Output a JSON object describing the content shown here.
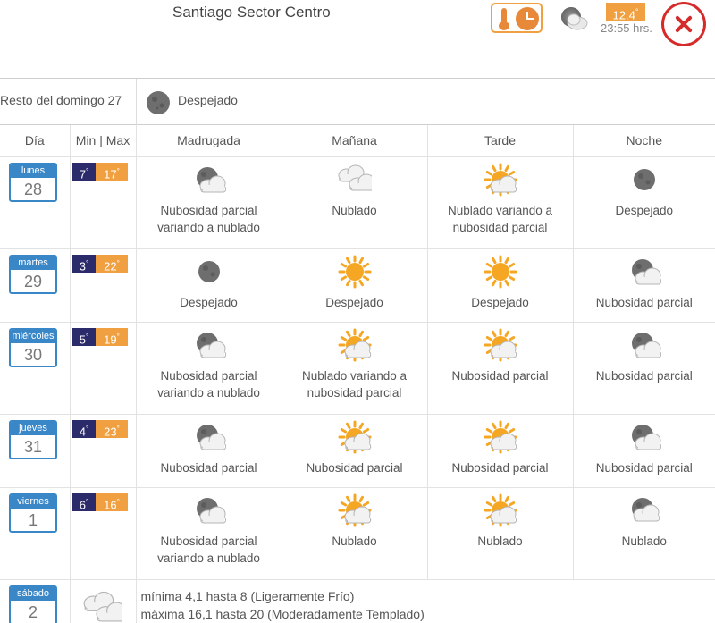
{
  "header": {
    "location": "Santiago Sector Centro",
    "current_temp": "12.4",
    "current_time": "23:55 hrs.",
    "current_icon": "partly-cloudy-night-icon"
  },
  "rest": {
    "label": "Resto del domingo 27",
    "desc": "Despejado",
    "icon": "clear-night-icon"
  },
  "table": {
    "headers": [
      "Día",
      "Min | Max",
      "Madrugada",
      "Mañana",
      "Tarde",
      "Noche"
    ],
    "days": [
      {
        "name": "lunes",
        "num": "28",
        "min": "7",
        "max": "17",
        "periods": [
          {
            "icon": "partly-cloudy-night",
            "desc": "Nubosidad parcial variando a nublado"
          },
          {
            "icon": "cloudy",
            "desc": "Nublado"
          },
          {
            "icon": "partly-cloudy-day",
            "desc": "Nublado variando a nubosidad parcial"
          },
          {
            "icon": "clear-night",
            "desc": "Despejado"
          }
        ]
      },
      {
        "name": "martes",
        "num": "29",
        "min": "3",
        "max": "22",
        "periods": [
          {
            "icon": "clear-night",
            "desc": "Despejado"
          },
          {
            "icon": "sunny",
            "desc": "Despejado"
          },
          {
            "icon": "sunny",
            "desc": "Despejado"
          },
          {
            "icon": "partly-cloudy-night",
            "desc": "Nubosidad parcial"
          }
        ]
      },
      {
        "name": "miércoles",
        "num": "30",
        "min": "5",
        "max": "19",
        "periods": [
          {
            "icon": "partly-cloudy-night",
            "desc": "Nubosidad parcial variando a nublado"
          },
          {
            "icon": "partly-cloudy-day",
            "desc": "Nublado variando a nubosidad parcial"
          },
          {
            "icon": "partly-cloudy-day",
            "desc": "Nubosidad parcial"
          },
          {
            "icon": "partly-cloudy-night",
            "desc": "Nubosidad parcial"
          }
        ]
      },
      {
        "name": "jueves",
        "num": "31",
        "min": "4",
        "max": "23",
        "periods": [
          {
            "icon": "partly-cloudy-night",
            "desc": "Nubosidad parcial"
          },
          {
            "icon": "partly-cloudy-day",
            "desc": "Nubosidad parcial"
          },
          {
            "icon": "partly-cloudy-day",
            "desc": "Nubosidad parcial"
          },
          {
            "icon": "partly-cloudy-night",
            "desc": "Nubosidad parcial"
          }
        ]
      },
      {
        "name": "viernes",
        "num": "1",
        "min": "6",
        "max": "16",
        "periods": [
          {
            "icon": "partly-cloudy-night",
            "desc": "Nubosidad parcial variando a nublado"
          },
          {
            "icon": "partly-cloudy-day",
            "desc": "Nublado"
          },
          {
            "icon": "partly-cloudy-day",
            "desc": "Nublado"
          },
          {
            "icon": "cloudy-night",
            "desc": "Nublado"
          }
        ]
      }
    ],
    "saturday": {
      "name": "sábado",
      "num": "2",
      "icon": "cloudy",
      "line1": "mínima 4,1 hasta 8 (Ligeramente Frío)",
      "line2": "máxima 16,1 hasta 20 (Moderadamente Templado)"
    }
  },
  "colors": {
    "accent_orange": "#f0a040",
    "day_blue": "#3a87c8",
    "min_navy": "#2b2a6b",
    "close_red": "#d62b2b"
  }
}
